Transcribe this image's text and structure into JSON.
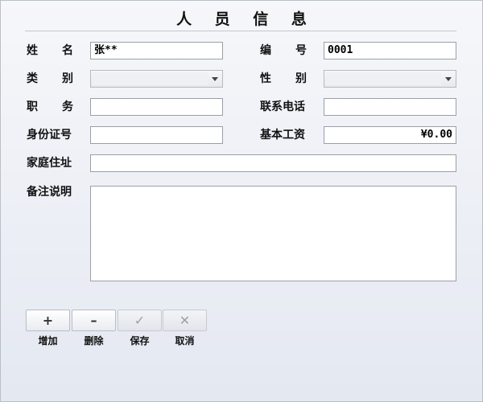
{
  "title": "人 员 信 息",
  "fields": {
    "name": {
      "label": [
        "姓",
        "名"
      ],
      "value": "张**"
    },
    "number": {
      "label": [
        "编",
        "号"
      ],
      "value": "0001"
    },
    "category": {
      "label": [
        "类",
        "别"
      ],
      "value": ""
    },
    "gender": {
      "label": [
        "性",
        "别"
      ],
      "value": ""
    },
    "position": {
      "label": [
        "职",
        "务"
      ],
      "value": ""
    },
    "phone": {
      "label": "联系电话",
      "value": ""
    },
    "id_number": {
      "label": "身份证号",
      "value": ""
    },
    "base_salary": {
      "label": "基本工资",
      "value": "¥0.00"
    },
    "address": {
      "label": "家庭住址",
      "value": ""
    },
    "notes": {
      "label": "备注说明",
      "value": ""
    }
  },
  "toolbar": {
    "add": {
      "icon": "plus-icon",
      "glyph": "+",
      "label": "增加"
    },
    "delete": {
      "icon": "minus-icon",
      "glyph": "–",
      "label": "删除"
    },
    "save": {
      "icon": "check-icon",
      "glyph": "✓",
      "label": "保存"
    },
    "cancel": {
      "icon": "x-icon",
      "glyph": "✕",
      "label": "取消"
    }
  }
}
